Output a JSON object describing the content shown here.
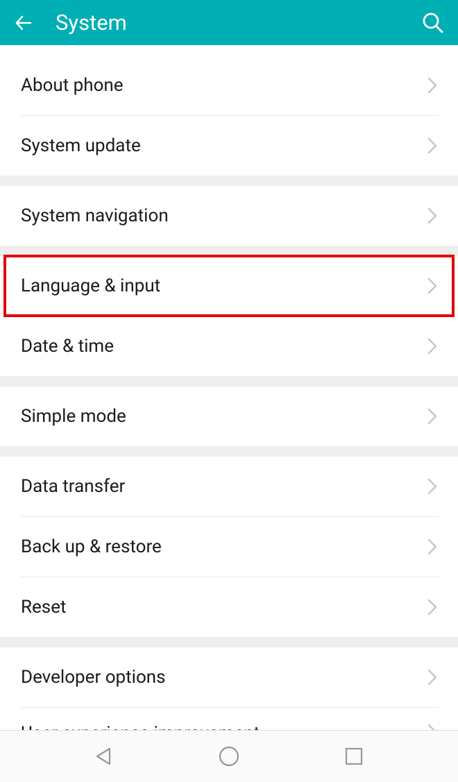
{
  "header": {
    "title": "System"
  },
  "items": {
    "about_phone": "About phone",
    "system_update": "System update",
    "system_navigation": "System navigation",
    "language_input": "Language & input",
    "date_time": "Date & time",
    "simple_mode": "Simple mode",
    "data_transfer": "Data transfer",
    "back_up_restore": "Back up & restore",
    "reset": "Reset",
    "developer_options": "Developer options",
    "user_experience": "User experience improvement"
  }
}
